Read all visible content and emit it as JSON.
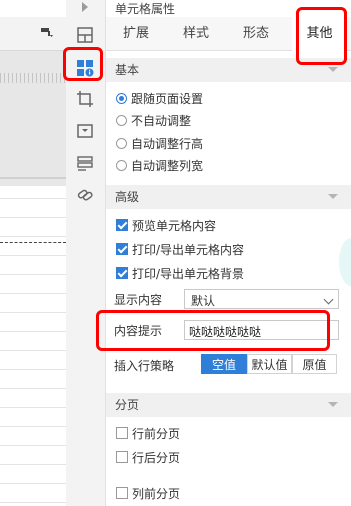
{
  "panel": {
    "title": "单元格属性",
    "tabs": [
      "扩展",
      "样式",
      "形态",
      "其他"
    ],
    "active_tab": "其他"
  },
  "strip_icons": [
    "chevron-right-icon",
    "cell-layout-icon",
    "cell-info-icon",
    "crop-icon",
    "dropdown-widget-icon",
    "list-icon",
    "link-icon"
  ],
  "basic": {
    "heading": "基本",
    "options": [
      "跟随页面设置",
      "不自动调整",
      "自动调整行高",
      "自动调整列宽"
    ],
    "selected": "跟随页面设置"
  },
  "advanced": {
    "heading": "高级",
    "checks": [
      {
        "label": "预览单元格内容",
        "checked": true
      },
      {
        "label": "打印/导出单元格内容",
        "checked": true
      },
      {
        "label": "打印/导出单元格背景",
        "checked": true
      }
    ],
    "display_label": "显示内容",
    "display_value": "默认",
    "tooltip_label": "内容提示",
    "tooltip_value": "哒哒哒哒哒哒",
    "insert_label": "插入行策略",
    "insert_options": [
      "空值",
      "默认值",
      "原值"
    ],
    "insert_selected": "空值"
  },
  "paging": {
    "heading": "分页",
    "checks": [
      {
        "label": "行前分页",
        "checked": false
      },
      {
        "label": "行后分页",
        "checked": false
      },
      {
        "label": "列前分页",
        "checked": false
      }
    ]
  },
  "colors": {
    "accent": "#2f7ed8",
    "highlight": "#ff0000"
  }
}
